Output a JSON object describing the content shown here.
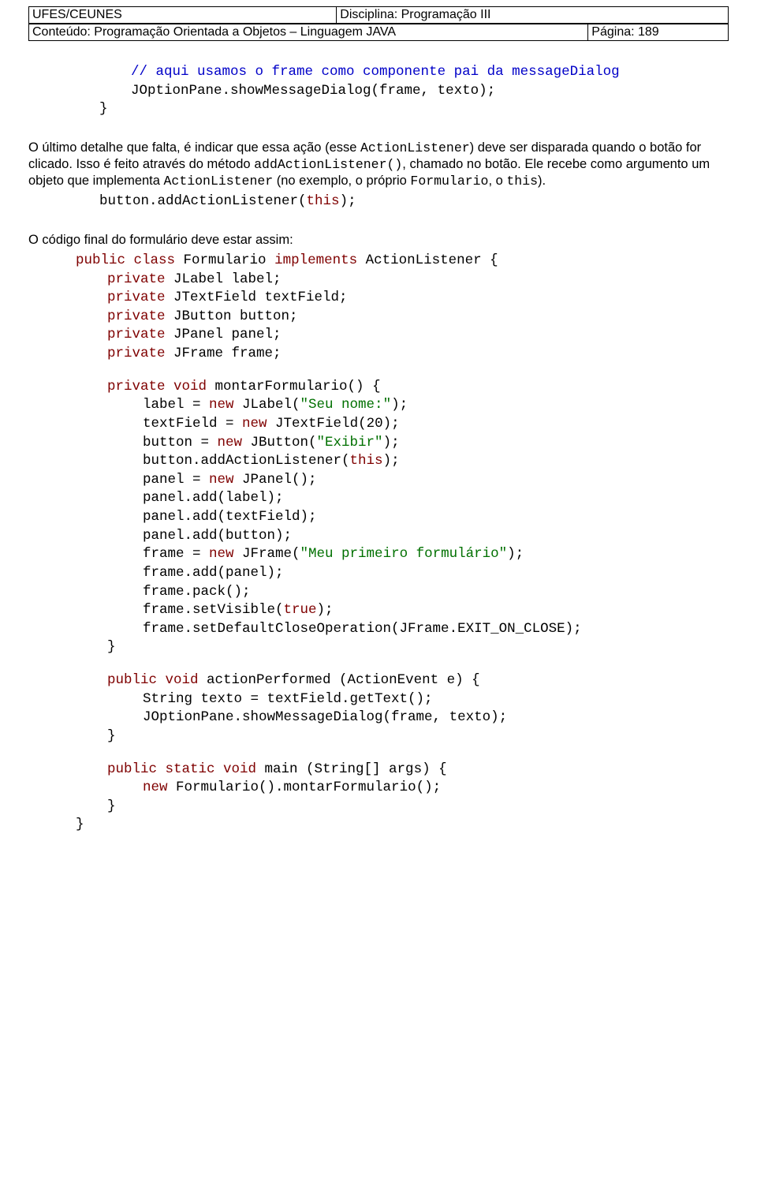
{
  "header": {
    "tl": "UFES/CEUNES",
    "tr": "Disciplina: Programação III",
    "bl": "Conteúdo: Programação Orientada a Objetos – Linguagem JAVA",
    "br": "Página: 189"
  },
  "c1": {
    "l1": "// aqui usamos o frame como componente pai da messageDialog",
    "l2": "JOptionPane.showMessageDialog(frame, texto);",
    "l3": "}"
  },
  "p1a": "O último detalhe que falta, é indicar que essa ação (esse ",
  "p1b": "ActionListener",
  "p1c": ") deve ser disparada quando o botão for clicado. Isso é feito através do método ",
  "p1d": "addActionListener()",
  "p1e": ", chamado no botão. Ele recebe como argumento um objeto que implementa ",
  "p1f": "ActionListener",
  "p1g": " (no exemplo, o próprio ",
  "p1h": "Formulario",
  "p1i": ", o ",
  "p1j": "this",
  "p1k": ").",
  "c2": "button.addActionListener(this);",
  "c2_this": "this",
  "p2": "O código final do formulário deve estar assim:",
  "code": {
    "l01a": "public class",
    "l01b": " Formulario ",
    "l01c": "implements",
    "l01d": " ActionListener {",
    "l02a": "private",
    "l02b": " JLabel label;",
    "l03a": "private",
    "l03b": " JTextField textField;",
    "l04a": "private",
    "l04b": " JButton button;",
    "l05a": "private",
    "l05b": " JPanel panel;",
    "l06a": "private",
    "l06b": " JFrame frame;",
    "l07a": "private void",
    "l07b": " montarFormulario() {",
    "l08a": "label = ",
    "l08b": "new",
    "l08c": " JLabel(",
    "l08d": "\"Seu nome:\"",
    "l08e": ");",
    "l09a": "textField = ",
    "l09b": "new",
    "l09c": " JTextField(20);",
    "l10a": "button = ",
    "l10b": "new",
    "l10c": " JButton(",
    "l10d": "\"Exibir\"",
    "l10e": ");",
    "l11a": "button.addActionListener(",
    "l11b": "this",
    "l11c": ");",
    "l12a": "panel = ",
    "l12b": "new",
    "l12c": " JPanel();",
    "l13": "panel.add(label);",
    "l14": "panel.add(textField);",
    "l15": "panel.add(button);",
    "l16a": "frame = ",
    "l16b": "new",
    "l16c": " JFrame(",
    "l16d": "\"Meu primeiro formulário\"",
    "l16e": ");",
    "l17": "frame.add(panel);",
    "l18": "frame.pack();",
    "l19a": "frame.setVisible(",
    "l19b": "true",
    "l19c": ");",
    "l20": "frame.setDefaultCloseOperation(JFrame.EXIT_ON_CLOSE);",
    "l21": "}",
    "l22a": "public void",
    "l22b": " actionPerformed (ActionEvent e) {",
    "l23": "String texto = textField.getText();",
    "l24": "JOptionPane.showMessageDialog(frame, texto);",
    "l25": "}",
    "l26a": "public static void",
    "l26b": " main (String[] args) {",
    "l27a": "new",
    "l27b": " Formulario().montarFormulario();",
    "l28": "}",
    "l29": "}"
  }
}
